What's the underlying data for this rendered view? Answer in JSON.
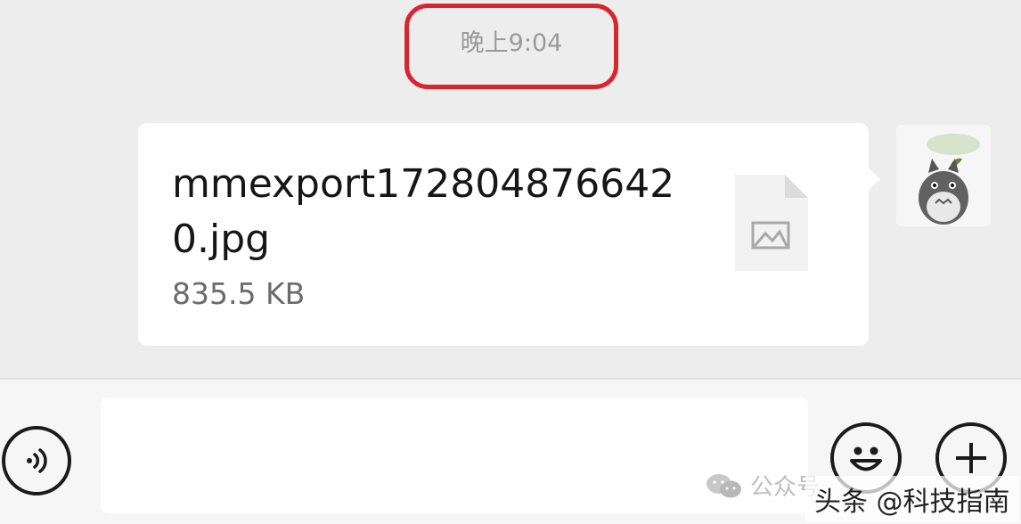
{
  "chat": {
    "timestamp": "晚上9:04",
    "message": {
      "file_name": "mmexport1728048766420.jpg",
      "file_size": "835.5 KB",
      "file_icon": "image-file-icon"
    },
    "sender_avatar": "totoro-avatar"
  },
  "input_bar": {
    "voice_icon": "voice-icon",
    "emoji_icon": "smiley-icon",
    "more_icon": "plus-icon"
  },
  "watermark": {
    "wechat_label": "公众号",
    "toutiao_label": "头条 @科技指南"
  },
  "colors": {
    "highlight": "#d8262c",
    "chat_background": "#ededed",
    "bubble": "#ffffff"
  }
}
